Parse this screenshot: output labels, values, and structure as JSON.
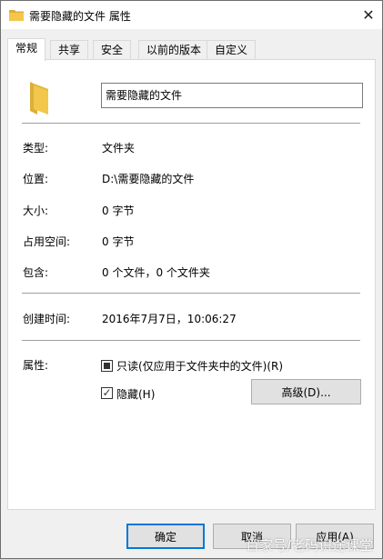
{
  "window": {
    "title": "需要隐藏的文件 属性",
    "close_glyph": "✕"
  },
  "tabs": [
    {
      "label": "常规",
      "active": true
    },
    {
      "label": "共享",
      "active": false
    },
    {
      "label": "安全",
      "active": false
    },
    {
      "label": "以前的版本",
      "active": false
    },
    {
      "label": "自定义",
      "active": false
    }
  ],
  "general": {
    "name_value": "需要隐藏的文件",
    "type_label": "类型:",
    "type_value": "文件夹",
    "location_label": "位置:",
    "location_value": "D:\\需要隐藏的文件",
    "size_label": "大小:",
    "size_value": "0 字节",
    "disk_size_label": "占用空间:",
    "disk_size_value": "0 字节",
    "contains_label": "包含:",
    "contains_value": "0 个文件，0 个文件夹",
    "created_label": "创建时间:",
    "created_value": "2016年7月7日，10:06:27",
    "attributes_label": "属性:",
    "readonly_label": "只读(仅应用于文件夹中的文件)(R)",
    "readonly_state": "indeterminate",
    "hidden_label": "隐藏(H)",
    "hidden_checked": true,
    "advanced_label": "高级(D)..."
  },
  "footer": {
    "ok_label": "确定",
    "cancel_label": "取消",
    "apply_label": "应用(A)"
  },
  "watermark": "百家号/老码识途课堂",
  "colors": {
    "accent": "#0078d7",
    "folder": "#f2c74a"
  }
}
